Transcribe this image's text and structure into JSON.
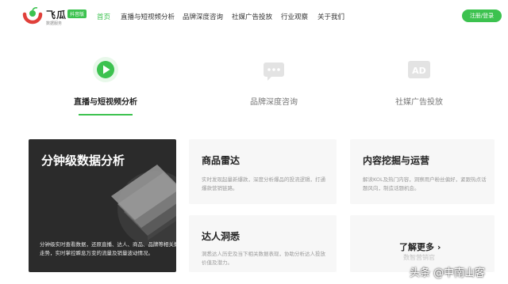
{
  "header": {
    "brand": "飞瓜",
    "badge": "抖音版",
    "slogan": "数据服务",
    "nav": [
      "首页",
      "直播与短视频分析",
      "品牌深度咨询",
      "社媒广告投放",
      "行业观察",
      "关于我们"
    ],
    "login_label": "注册/登录"
  },
  "tabs": [
    {
      "label": "直播与短视频分析",
      "icon": "play-icon",
      "active": true
    },
    {
      "label": "品牌深度咨询",
      "icon": "chat-bubble-icon",
      "active": false
    },
    {
      "label": "社媒广告投放",
      "icon": "ad-icon",
      "active": false
    }
  ],
  "tab_icon_text": "AD",
  "featured": {
    "title": "分钟级数据分析",
    "desc": "分钟级实时查看数据，还原直播、达人、商品、品牌等相关数据及走势，实时掌控瞬息万变的流量及销量波动情况。"
  },
  "cards": [
    {
      "title": "商品雷达",
      "desc": "实时发现起量新爆款，深度分析爆品的投流逻辑，打通爆款营销链路。"
    },
    {
      "title": "内容挖掘与运营",
      "desc": "解读KOL及热门内容，洞察用户粉丝偏好，紧跟热点话题风向，制造话题机会。"
    },
    {
      "title": "达人洞悉",
      "desc": "洞悉达人历史及当下相关数据表现，协助分析达人投放价值及潜力。"
    }
  ],
  "more": {
    "label": "了解更多",
    "arrow": "›"
  },
  "watermark": {
    "line1": "数智营销官",
    "line2": "头条 @中南山客"
  },
  "colors": {
    "accent": "#3cc24f",
    "dark_card": "#2b2b2b",
    "light_card": "#f7f7f7"
  }
}
